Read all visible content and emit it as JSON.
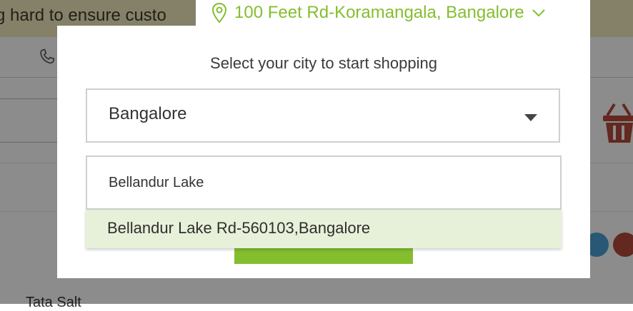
{
  "background": {
    "banner_text": "g hard to ensure custo",
    "product_label": "Tata Salt"
  },
  "location_bar": {
    "address": "100 Feet Rd-Koramangala, Bangalore",
    "pin_icon": "map-pin-icon",
    "chevron_icon": "chevron-down-icon"
  },
  "modal": {
    "title": "Select your city to start shopping",
    "city_select": {
      "value": "Bangalore",
      "caret_icon": "caret-down-icon"
    },
    "area_input": {
      "value": "Bellandur Lake"
    },
    "suggestions": [
      "Bellandur Lake Rd-560103,Bangalore"
    ]
  },
  "colors": {
    "accent": "#84be2f",
    "suggestion_highlight": "#e7f0d9",
    "banner": "#f3ecc0"
  }
}
